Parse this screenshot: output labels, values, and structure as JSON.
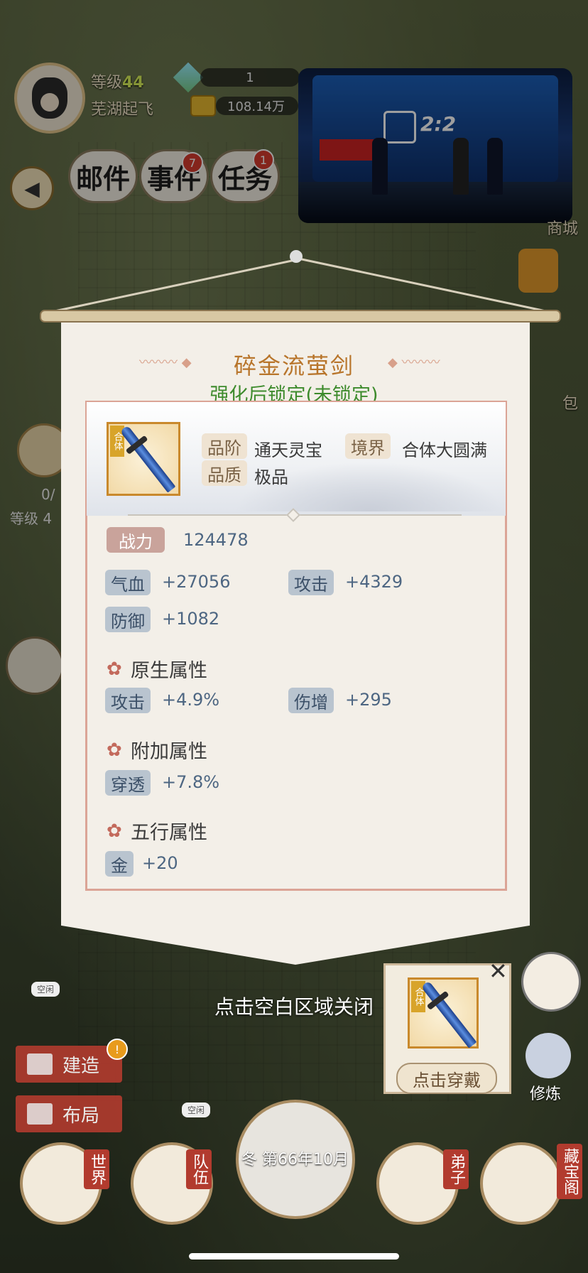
{
  "player": {
    "level_label": "等级",
    "level": "44",
    "name": "芜湖起飞",
    "gems": "1",
    "gold": "108.14万"
  },
  "top_buttons": [
    {
      "label": "邮件"
    },
    {
      "label": "事件",
      "badge": "7"
    },
    {
      "label": "任务",
      "badge": "1"
    }
  ],
  "video": {
    "score": "2:2"
  },
  "right_side": {
    "shop": "商城",
    "bag": "包"
  },
  "left_side": {
    "progress": "0/",
    "level_text": "等级 4"
  },
  "dialog": {
    "title": "碎金流萤剑",
    "subtitle": "强化后锁定(未锁定)",
    "item_tag": "合体",
    "grade_label": "品阶",
    "grade_value": "通天灵宝",
    "realm_label": "境界",
    "realm_value": "合体大圆满",
    "quality_label": "品质",
    "quality_value": "极品",
    "power_label": "战力",
    "power_value": "124478",
    "base_stats": [
      {
        "label": "气血",
        "value": "+27056"
      },
      {
        "label": "攻击",
        "value": "+4329"
      },
      {
        "label": "防御",
        "value": "+1082"
      }
    ],
    "native_title": "原生属性",
    "native_stats": [
      {
        "label": "攻击",
        "value": "+4.9%"
      },
      {
        "label": "伤增",
        "value": "+295"
      }
    ],
    "extra_title": "附加属性",
    "extra_stats": [
      {
        "label": "穿透",
        "value": "+7.8%"
      }
    ],
    "element_title": "五行属性",
    "element_stats": [
      {
        "label": "金",
        "value": "+20"
      }
    ],
    "close_hint": "点击空白区域关闭"
  },
  "equip_popup": {
    "item_tag": "合体",
    "button": "点击穿戴",
    "close": "✕"
  },
  "bottom": {
    "build": "建造",
    "layout": "布局",
    "idle1": "空闲",
    "idle2": "空闲",
    "cultivate": "修炼",
    "nav": [
      {
        "label": "世界"
      },
      {
        "label": "队伍"
      },
      {
        "label": "弟子"
      },
      {
        "label": "藏宝阁"
      }
    ],
    "season": "冬",
    "date": "第66年10月"
  },
  "colors": {
    "title": "#b8752b",
    "subtitle": "#3d8b2c",
    "panel_border": "#dba496",
    "chip_bg": "#b9c4cf",
    "value_text": "#4d6682"
  }
}
